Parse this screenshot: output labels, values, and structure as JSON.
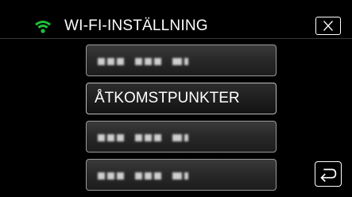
{
  "header": {
    "title": "WI-FI-INSTÄLLNING",
    "wifi_icon": "wifi-icon",
    "wifi_color": "#1fbf3a",
    "close_icon": "close-icon"
  },
  "menu": {
    "items": [
      {
        "label": "",
        "masked": true
      },
      {
        "label": "ÅTKOMSTPUNKTER",
        "masked": false
      },
      {
        "label": "",
        "masked": true
      },
      {
        "label": "",
        "masked": true
      }
    ]
  },
  "footer": {
    "return_icon": "return-icon"
  }
}
